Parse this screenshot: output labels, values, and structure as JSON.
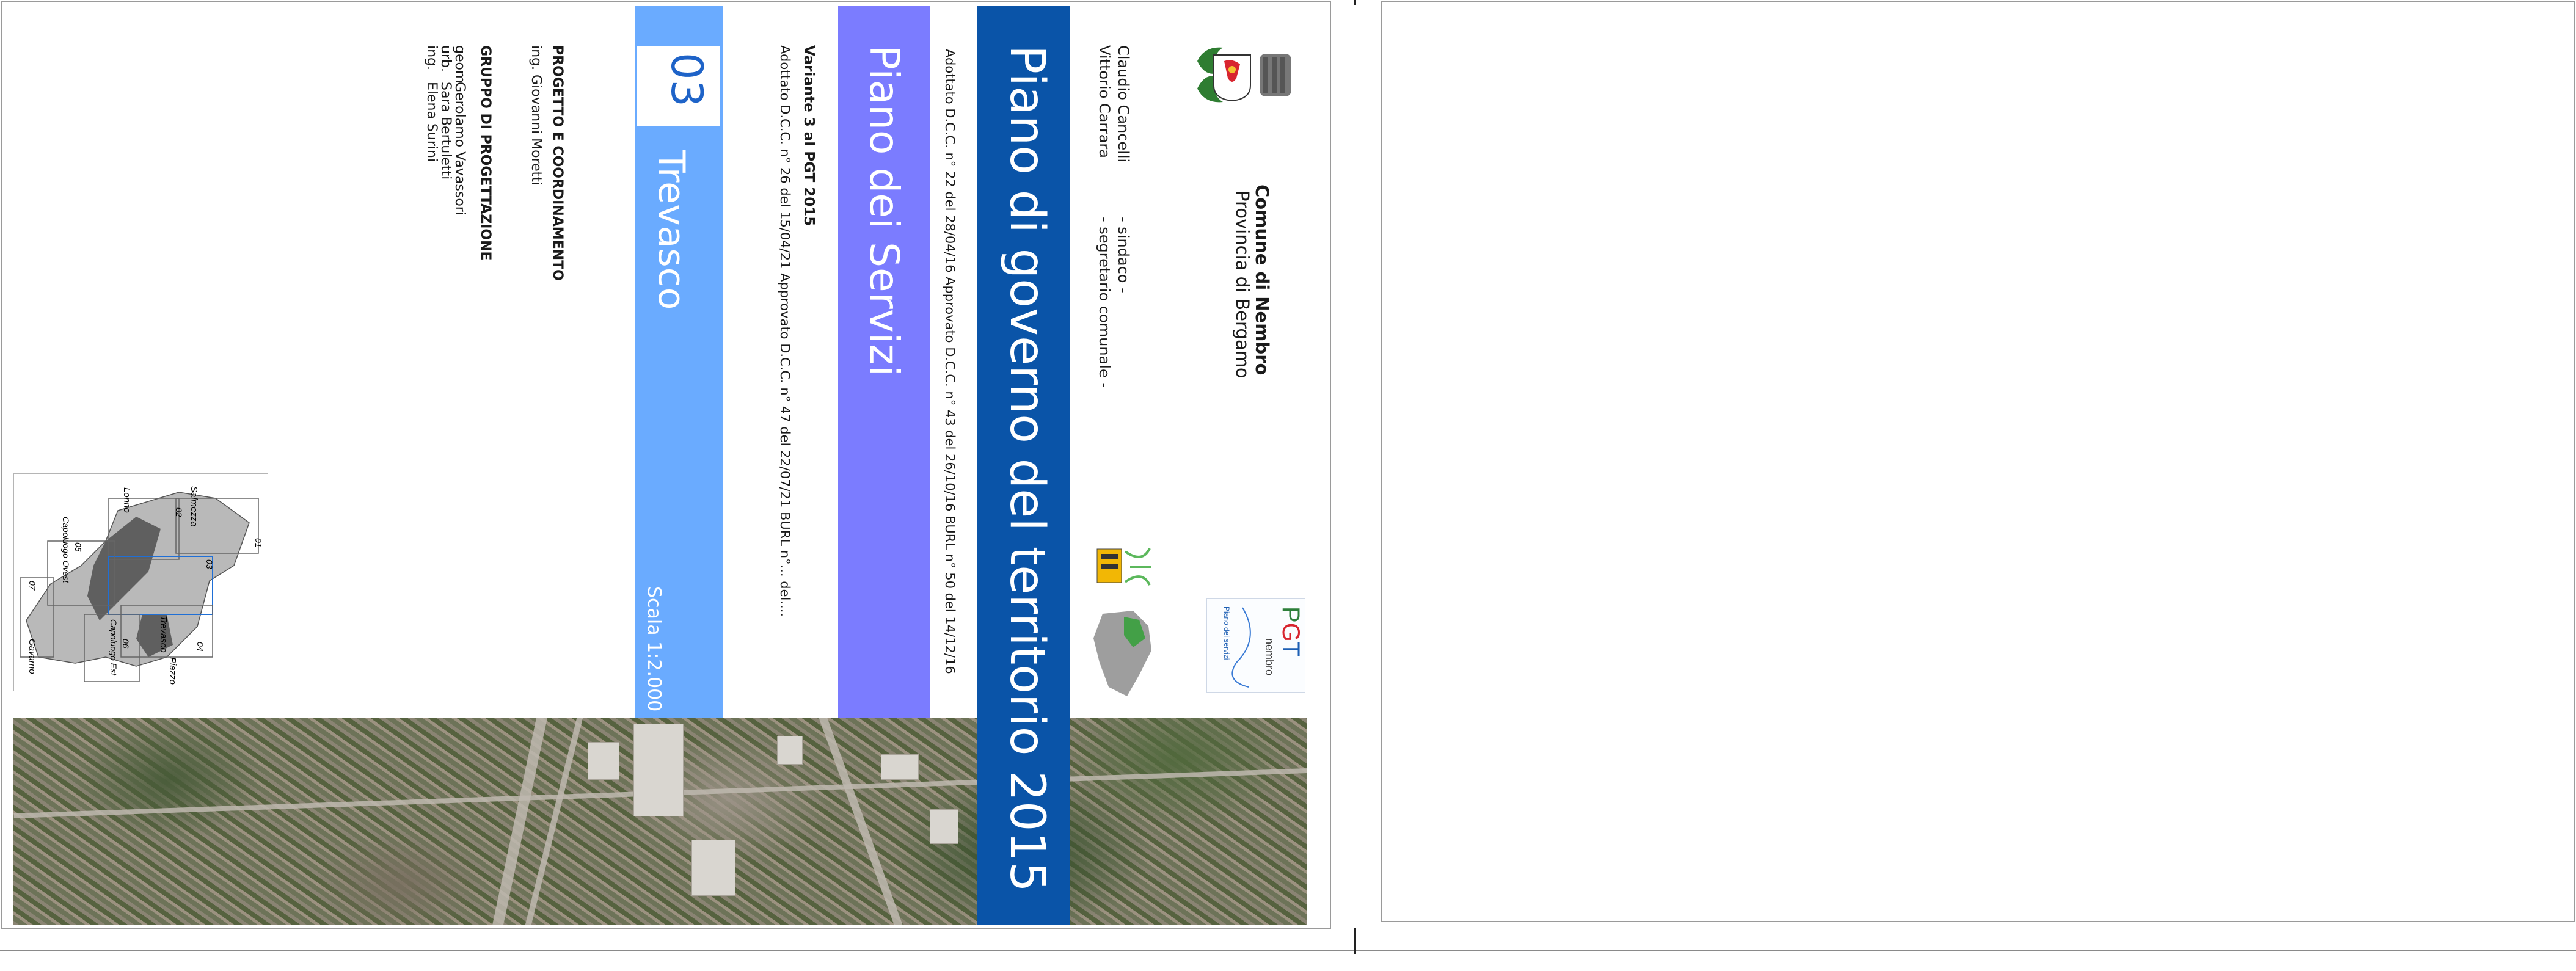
{
  "municipality": {
    "name": "Comune di Nembro",
    "province": "Provincia di Bergamo"
  },
  "officials": [
    {
      "name": "Claudio Cancelli",
      "role": "- sindaco -"
    },
    {
      "name": "Vittorio Carrara",
      "role": "- segretario comunale -"
    }
  ],
  "plan": {
    "title": "Piano di governo del territorio 2015",
    "adoption": "Adottato D.C.C. n° 22 del 28/04/16 Approvato D.C.C. n° 43 del 26/10/16  BURL n° 50 del 14/12/16",
    "section": "Piano dei Servizi",
    "variant_title": "Variante 3 al PGT 2015",
    "variant_adoption": "Adottato D.C.C. n°  26 del 15/04/21   Approvato D.C.C. n° 47 del 22/07/21    BURL n°... del....",
    "sheet_number": "03",
    "sheet_name": "Trevasco",
    "scale": "Scala 1:2.000"
  },
  "credits": {
    "coord_heading": "PROGETTO E COORDINAMENTO",
    "coord_name": "ing. Giovanni Moretti",
    "group_heading": "GRUPPO DI PROGETTAZIONE",
    "group_prefixes": [
      "geom.",
      "urb.",
      "ing."
    ],
    "group_names": [
      "Gerolamo Vavassori",
      "Sara Bertuletti",
      "Elena Surini"
    ]
  },
  "logos": {
    "pgt_letters": [
      "P",
      "G",
      "T"
    ],
    "pgt_sub": "nembro",
    "pgt_small": "Piano dei servizi",
    "icons": [
      "coat-of-arms-icon",
      "pgt-logo",
      "mascot-logo",
      "territory-map-icon"
    ]
  },
  "keymap": {
    "labels": [
      "Salmezza",
      "Lonno",
      "Capoluogo Ovest",
      "Trevasco",
      "Gavarno",
      "Capoluogo Est",
      "Piazzo"
    ],
    "numbers": [
      "01",
      "02",
      "03",
      "04",
      "05",
      "06",
      "07"
    ]
  },
  "colors": {
    "title_band": "#0a54a8",
    "section_band": "#7b7cff",
    "sheet_band": "#6aabff",
    "frame": "#9a9a9a"
  }
}
